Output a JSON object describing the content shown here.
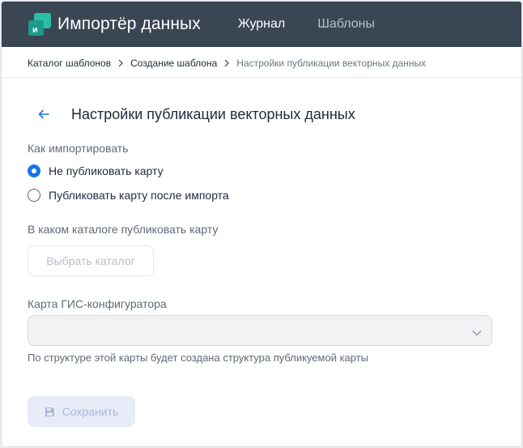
{
  "app": {
    "title": "Импортёр данных"
  },
  "nav": {
    "items": [
      {
        "label": "Журнал"
      },
      {
        "label": "Шаблоны"
      }
    ]
  },
  "breadcrumb": {
    "items": [
      "Каталог шаблонов",
      "Создание шаблона"
    ],
    "current": "Настройки публикации векторных данных"
  },
  "page": {
    "title": "Настройки публикации векторных данных"
  },
  "import_mode": {
    "label": "Как импортировать",
    "options": [
      {
        "label": "Не публиковать карту",
        "selected": true
      },
      {
        "label": "Публиковать карту после импорта",
        "selected": false
      }
    ]
  },
  "catalog": {
    "label": "В каком каталоге публиковать карту",
    "button_label": "Выбрать каталог"
  },
  "gis_map": {
    "label": "Карта ГИС-конфигуратора",
    "value": "",
    "hint": "По структуре этой карты будет создана структура публикуемой карты"
  },
  "actions": {
    "save_label": "Сохранить"
  },
  "colors": {
    "topbar": "#3a4654",
    "accent": "#1a73e8",
    "logo_teal": "#2bbfa6"
  },
  "icons": {
    "logo": "app-logo-icon",
    "back": "arrow-left-icon",
    "separator": "chevron-right-icon",
    "dropdown": "chevron-down-icon",
    "save": "floppy-disk-icon"
  }
}
